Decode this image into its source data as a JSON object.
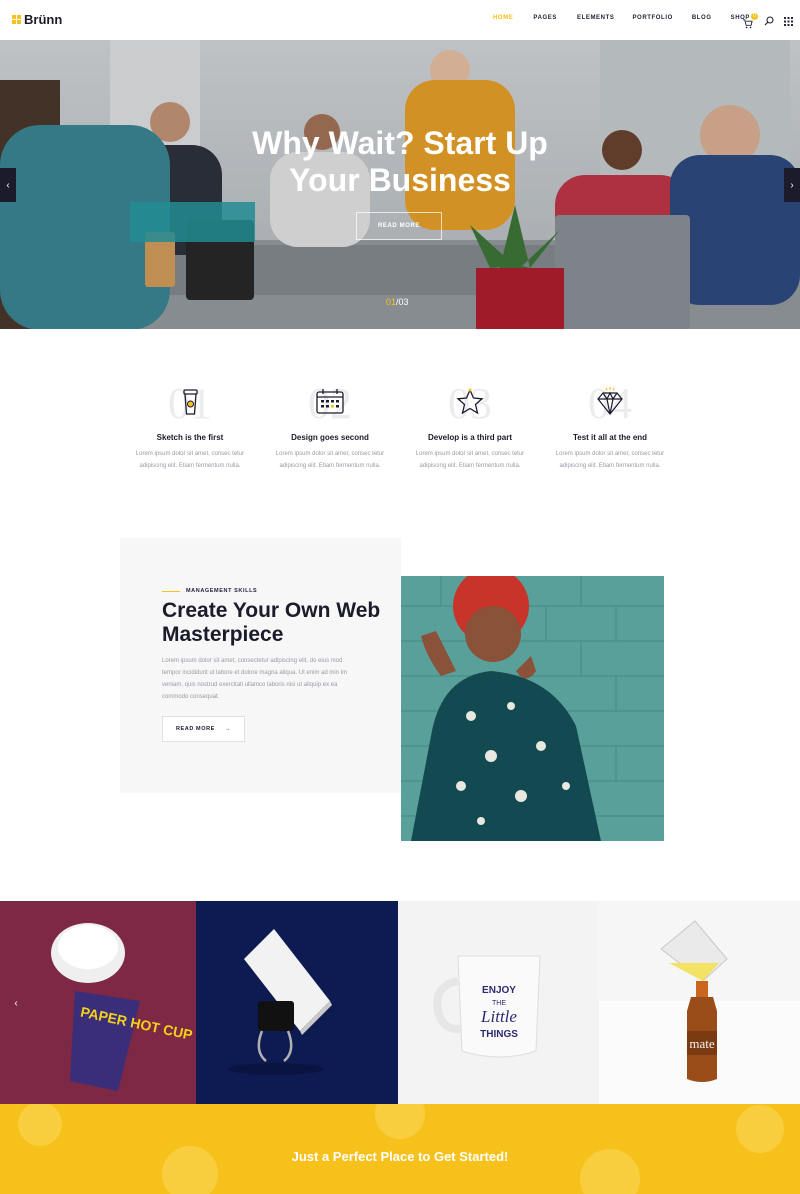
{
  "header": {
    "logo": "Brünn",
    "nav": [
      "HOME",
      "PAGES",
      "ELEMENTS",
      "PORTFOLIO",
      "BLOG",
      "SHOP"
    ],
    "active_nav": "HOME",
    "cart_count": "0"
  },
  "hero": {
    "title_line1_pre": "Why Wait? ",
    "title_line1_hl": "Start Up",
    "title_line2": "Your Business",
    "button": "READ MORE",
    "counter_current": "01",
    "counter_total": "/03"
  },
  "features": [
    {
      "num": "01",
      "icon": "coffee-cup-icon",
      "title": "Sketch is the first",
      "text": "Lorem ipsum dolor sit amet, consec tetur adipiscing elit. Etiam fermentum nulla."
    },
    {
      "num": "02",
      "icon": "calendar-icon",
      "title": "Design goes second",
      "text": "Lorem ipsum dolor sit amet, consec tetur adipiscing elit. Etiam fermentum nulla."
    },
    {
      "num": "03",
      "icon": "star-icon",
      "title": "Develop is a third part",
      "text": "Lorem ipsum dolor sit amet, consec tetur adipiscing elit. Etiam fermentum nulla."
    },
    {
      "num": "04",
      "icon": "diamond-icon",
      "title": "Test it all at the end",
      "text": "Lorem ipsum dolor sit amet, consec tetur adipiscing elit. Etiam fermentum nulla."
    }
  ],
  "about": {
    "tag": "MANAGEMENT SKILLS",
    "title": "Create Your Own Web Masterpiece",
    "text": "Lorem ipsum dolor sit amet, consectetur adipiscing elit, do eius mod tempor incididunt ut labore et dolore magna aliqua. Ut enim ad min im veniam, quis nostrud exercitati ullamco laboris nisi ut aliquip ex ea commodo consequat.",
    "button": "READ MORE"
  },
  "gallery": {
    "cup_text": "PAPER HOT CUP COFFEE MOCKUP",
    "mug_text": [
      "ENJOY",
      "THE",
      "Little",
      "THINGS"
    ],
    "bottle_text": "mate"
  },
  "cta": {
    "text": "Just a Perfect Place to Get Started!"
  },
  "colors": {
    "accent": "#f7c11c",
    "dark": "#1b1b2b"
  }
}
